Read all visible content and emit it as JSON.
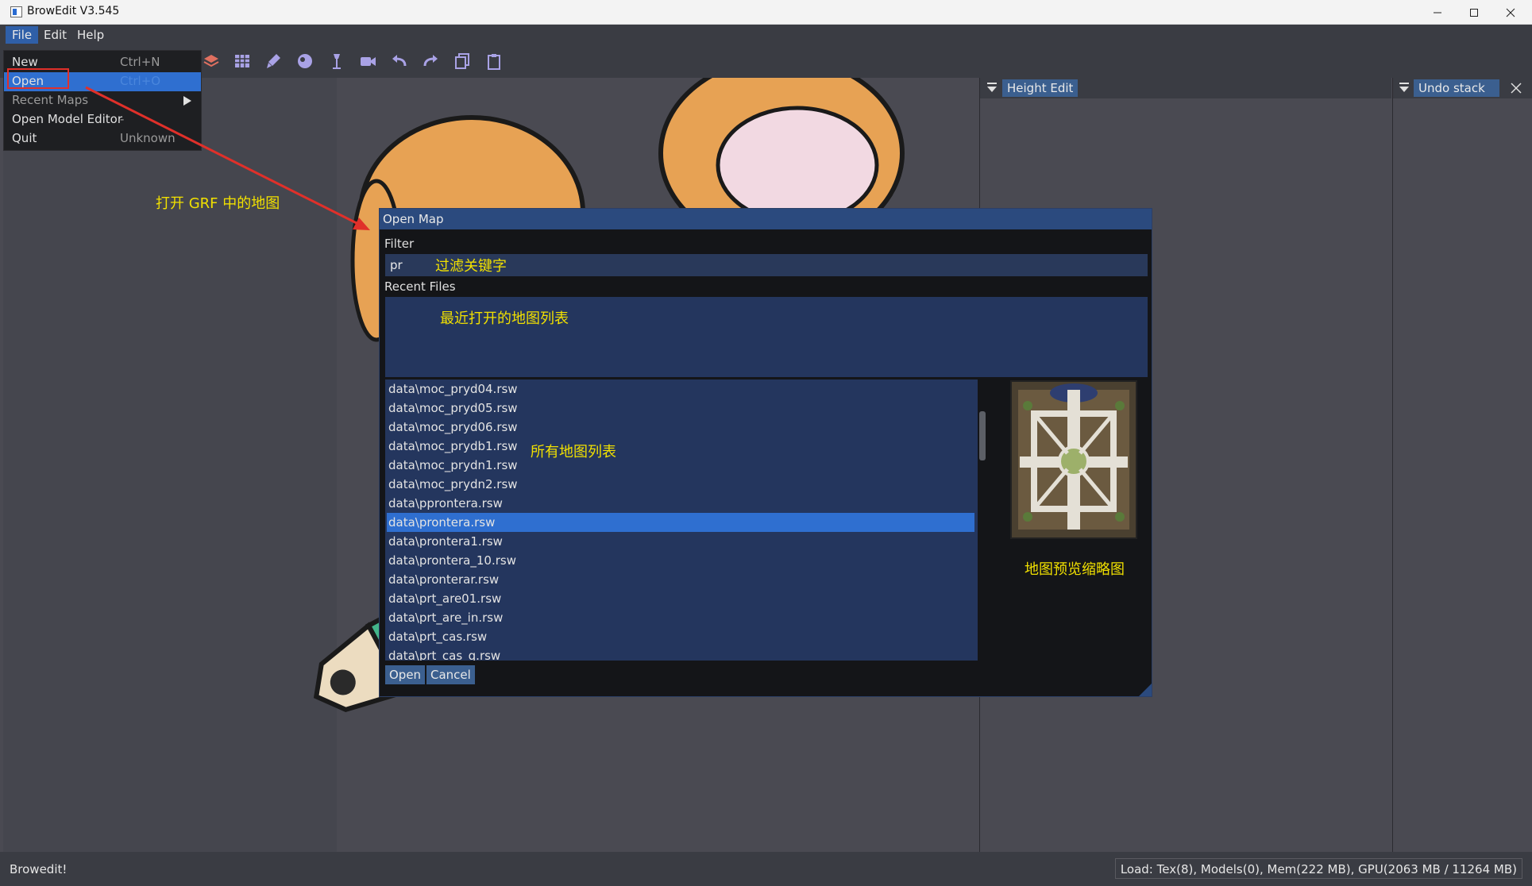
{
  "window": {
    "title": "BrowEdit V3.545"
  },
  "menubar": [
    {
      "label": "File"
    },
    {
      "label": "Edit"
    },
    {
      "label": "Help"
    }
  ],
  "file_menu": [
    {
      "label": "New",
      "shortcut": "Ctrl+N"
    },
    {
      "label": "Open",
      "shortcut": "Ctrl+O"
    },
    {
      "label": "Recent Maps"
    },
    {
      "label": "Open Model Editor",
      "shortcut": "-"
    },
    {
      "label": "Quit",
      "shortcut": "Unknown"
    }
  ],
  "panels": {
    "height_edit": "Height Edit",
    "undo_stack": "Undo stack"
  },
  "dialog": {
    "title": "Open Map",
    "filter_label": "Filter",
    "filter_value": "pr",
    "recent_label": "Recent Files",
    "files": [
      "data\\moc_pryd04.rsw",
      "data\\moc_pryd05.rsw",
      "data\\moc_pryd06.rsw",
      "data\\moc_prydb1.rsw",
      "data\\moc_prydn1.rsw",
      "data\\moc_prydn2.rsw",
      "data\\pprontera.rsw",
      "data\\prontera.rsw",
      "data\\prontera1.rsw",
      "data\\prontera_10.rsw",
      "data\\pronterar.rsw",
      "data\\prt_are01.rsw",
      "data\\prt_are_in.rsw",
      "data\\prt_cas.rsw",
      "data\\prt_cas_q.rsw"
    ],
    "selected_file": "data\\prontera.rsw",
    "open_button": "Open",
    "cancel_button": "Cancel"
  },
  "annotations": {
    "open_grf": "打开 GRF 中的地图",
    "filter_keyword": "过滤关键字",
    "recent_list": "最近打开的地图列表",
    "all_maps": "所有地图列表",
    "preview": "地图预览缩略图"
  },
  "status": {
    "left": "Browedit!",
    "right": "Load: Tex(8), Models(0), Mem(222 MB), GPU(2063 MB / 11264 MB)"
  },
  "colors": {
    "accent": "#2f6fd0",
    "annotation_text": "#f1e000",
    "annotation_arrow": "#e0302a"
  }
}
